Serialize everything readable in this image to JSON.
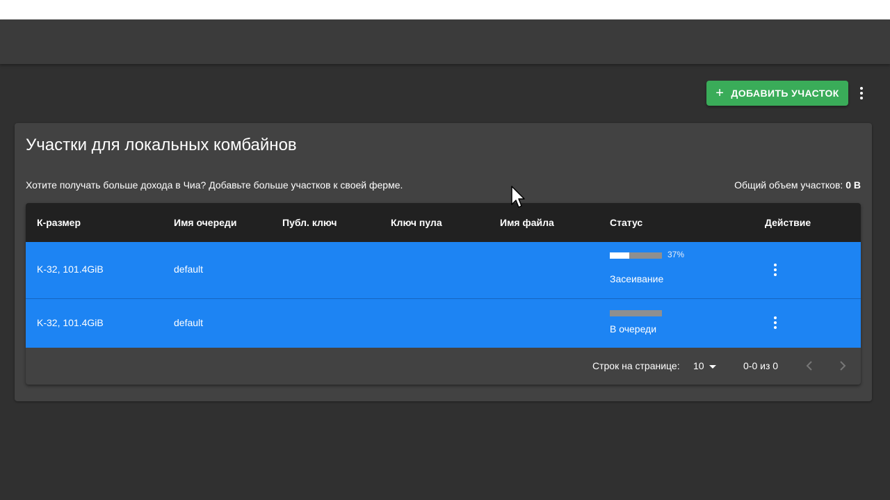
{
  "toolbar": {
    "add_plot_label": "ДОБАВИТЬ УЧАСТОК"
  },
  "card": {
    "title": "Участки для локальных комбайнов",
    "description": "Хотите получать больше дохода в Чиа? Добавьте больше участков к своей ферме.",
    "total_label": "Общий объем участков:",
    "total_value": "0 B"
  },
  "table": {
    "columns": [
      "К-размер",
      "Имя очереди",
      "Публ. ключ",
      "Ключ пула",
      "Имя файла",
      "Статус",
      "Действие"
    ],
    "rows": [
      {
        "k_size": "K-32, 101.4GiB",
        "queue_name": "default",
        "public_key": "",
        "pool_key": "",
        "filename": "",
        "progress": 0.37,
        "progress_label": "37%",
        "status": "Засеивание"
      },
      {
        "k_size": "K-32, 101.4GiB",
        "queue_name": "default",
        "public_key": "",
        "pool_key": "",
        "filename": "",
        "progress": 0,
        "status": "В очереди"
      }
    ]
  },
  "pagination": {
    "rows_per_page_label": "Строк на странице:",
    "rows_per_page_value": "10",
    "range": "0-0 из 0"
  },
  "colors": {
    "accent_green": "#3aac59",
    "row_highlight": "#1d84f3",
    "card_bg": "#424242",
    "header_bg": "#212121"
  },
  "icons": {
    "add": "plus-icon",
    "more": "more-vert-icon",
    "prev": "chevron-left-icon",
    "next": "chevron-right-icon",
    "dropdown": "caret-down-icon"
  }
}
